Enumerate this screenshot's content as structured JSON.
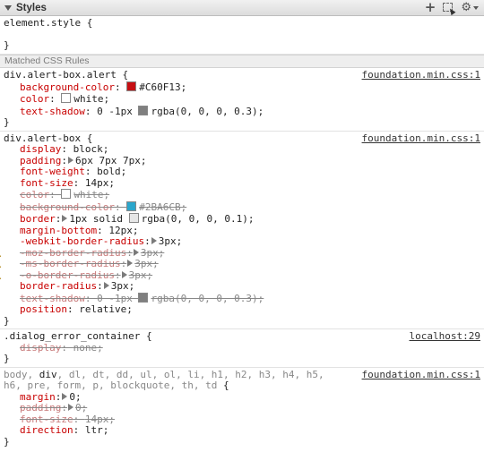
{
  "header": {
    "title": "Styles"
  },
  "element_style": {
    "selector": "element.style {",
    "close": "}"
  },
  "matched_label": "Matched CSS Rules",
  "rules": [
    {
      "selector": "div.alert-box.alert {",
      "source": "foundation.min.css:1",
      "props": [
        {
          "name": "background-color",
          "value": "#C60F13;",
          "swatch": "#C60F13",
          "disabled": false
        },
        {
          "name": "color",
          "value": "white;",
          "swatch": "#ffffff",
          "disabled": false
        },
        {
          "name": "text-shadow",
          "pre": "0 -1px ",
          "value": "rgba(0, 0, 0, 0.3);",
          "swatch": "#7f7f7f",
          "disabled": false
        }
      ]
    },
    {
      "selector": "div.alert-box {",
      "source": "foundation.min.css:1",
      "props": [
        {
          "name": "display",
          "value": "block;"
        },
        {
          "name": "padding",
          "value": "6px 7px 7px;",
          "expand": true
        },
        {
          "name": "font-weight",
          "value": "bold;"
        },
        {
          "name": "font-size",
          "value": "14px;"
        },
        {
          "name": "color",
          "value": "white;",
          "swatch": "#ffffff",
          "disabled": true
        },
        {
          "name": "background-color",
          "value": "#2BA6CB;",
          "swatch": "#2BA6CB",
          "disabled": true
        },
        {
          "name": "border",
          "pre": "1px solid ",
          "value": "rgba(0, 0, 0, 0.1);",
          "swatch": "#e6e6e6",
          "expand": true
        },
        {
          "name": "margin-bottom",
          "value": "12px;"
        },
        {
          "name": "-webkit-border-radius",
          "value": "3px;",
          "expand": true
        },
        {
          "name": "-moz-border-radius",
          "value": "3px;",
          "expand": true,
          "disabled": true,
          "warn": true
        },
        {
          "name": "-ms-border-radius",
          "value": "3px;",
          "expand": true,
          "disabled": true,
          "warn": true
        },
        {
          "name": "-o-border-radius",
          "value": "3px;",
          "expand": true,
          "disabled": true,
          "warn": true
        },
        {
          "name": "border-radius",
          "value": "3px;",
          "expand": true
        },
        {
          "name": "text-shadow",
          "pre": "0 -1px ",
          "value": "rgba(0, 0, 0, 0.3);",
          "swatch": "#7f7f7f",
          "disabled": true
        },
        {
          "name": "position",
          "value": "relative;"
        }
      ]
    },
    {
      "selector": ".dialog_error_container {",
      "source": "localhost:29",
      "props": [
        {
          "name": "display",
          "value": "none;",
          "disabled": true
        }
      ]
    }
  ],
  "inherited": {
    "selector_line1_pre": "body, ",
    "selector_hi": "div",
    "selector_line1_post": ", dl, dt, dd, ul, ol, li, h1, h2, h3, h4, h5,",
    "selector_line2": "h6, pre, form, p, blockquote, th, td",
    "selector_brace": " {",
    "source": "foundation.min.css:1",
    "props": [
      {
        "name": "margin",
        "value": "0;",
        "expand": true
      },
      {
        "name": "padding",
        "value": "0;",
        "expand": true,
        "disabled": true
      },
      {
        "name": "font-size",
        "value": "14px;",
        "disabled": true
      },
      {
        "name": "direction",
        "value": "ltr;"
      }
    ]
  },
  "close_brace": "}"
}
